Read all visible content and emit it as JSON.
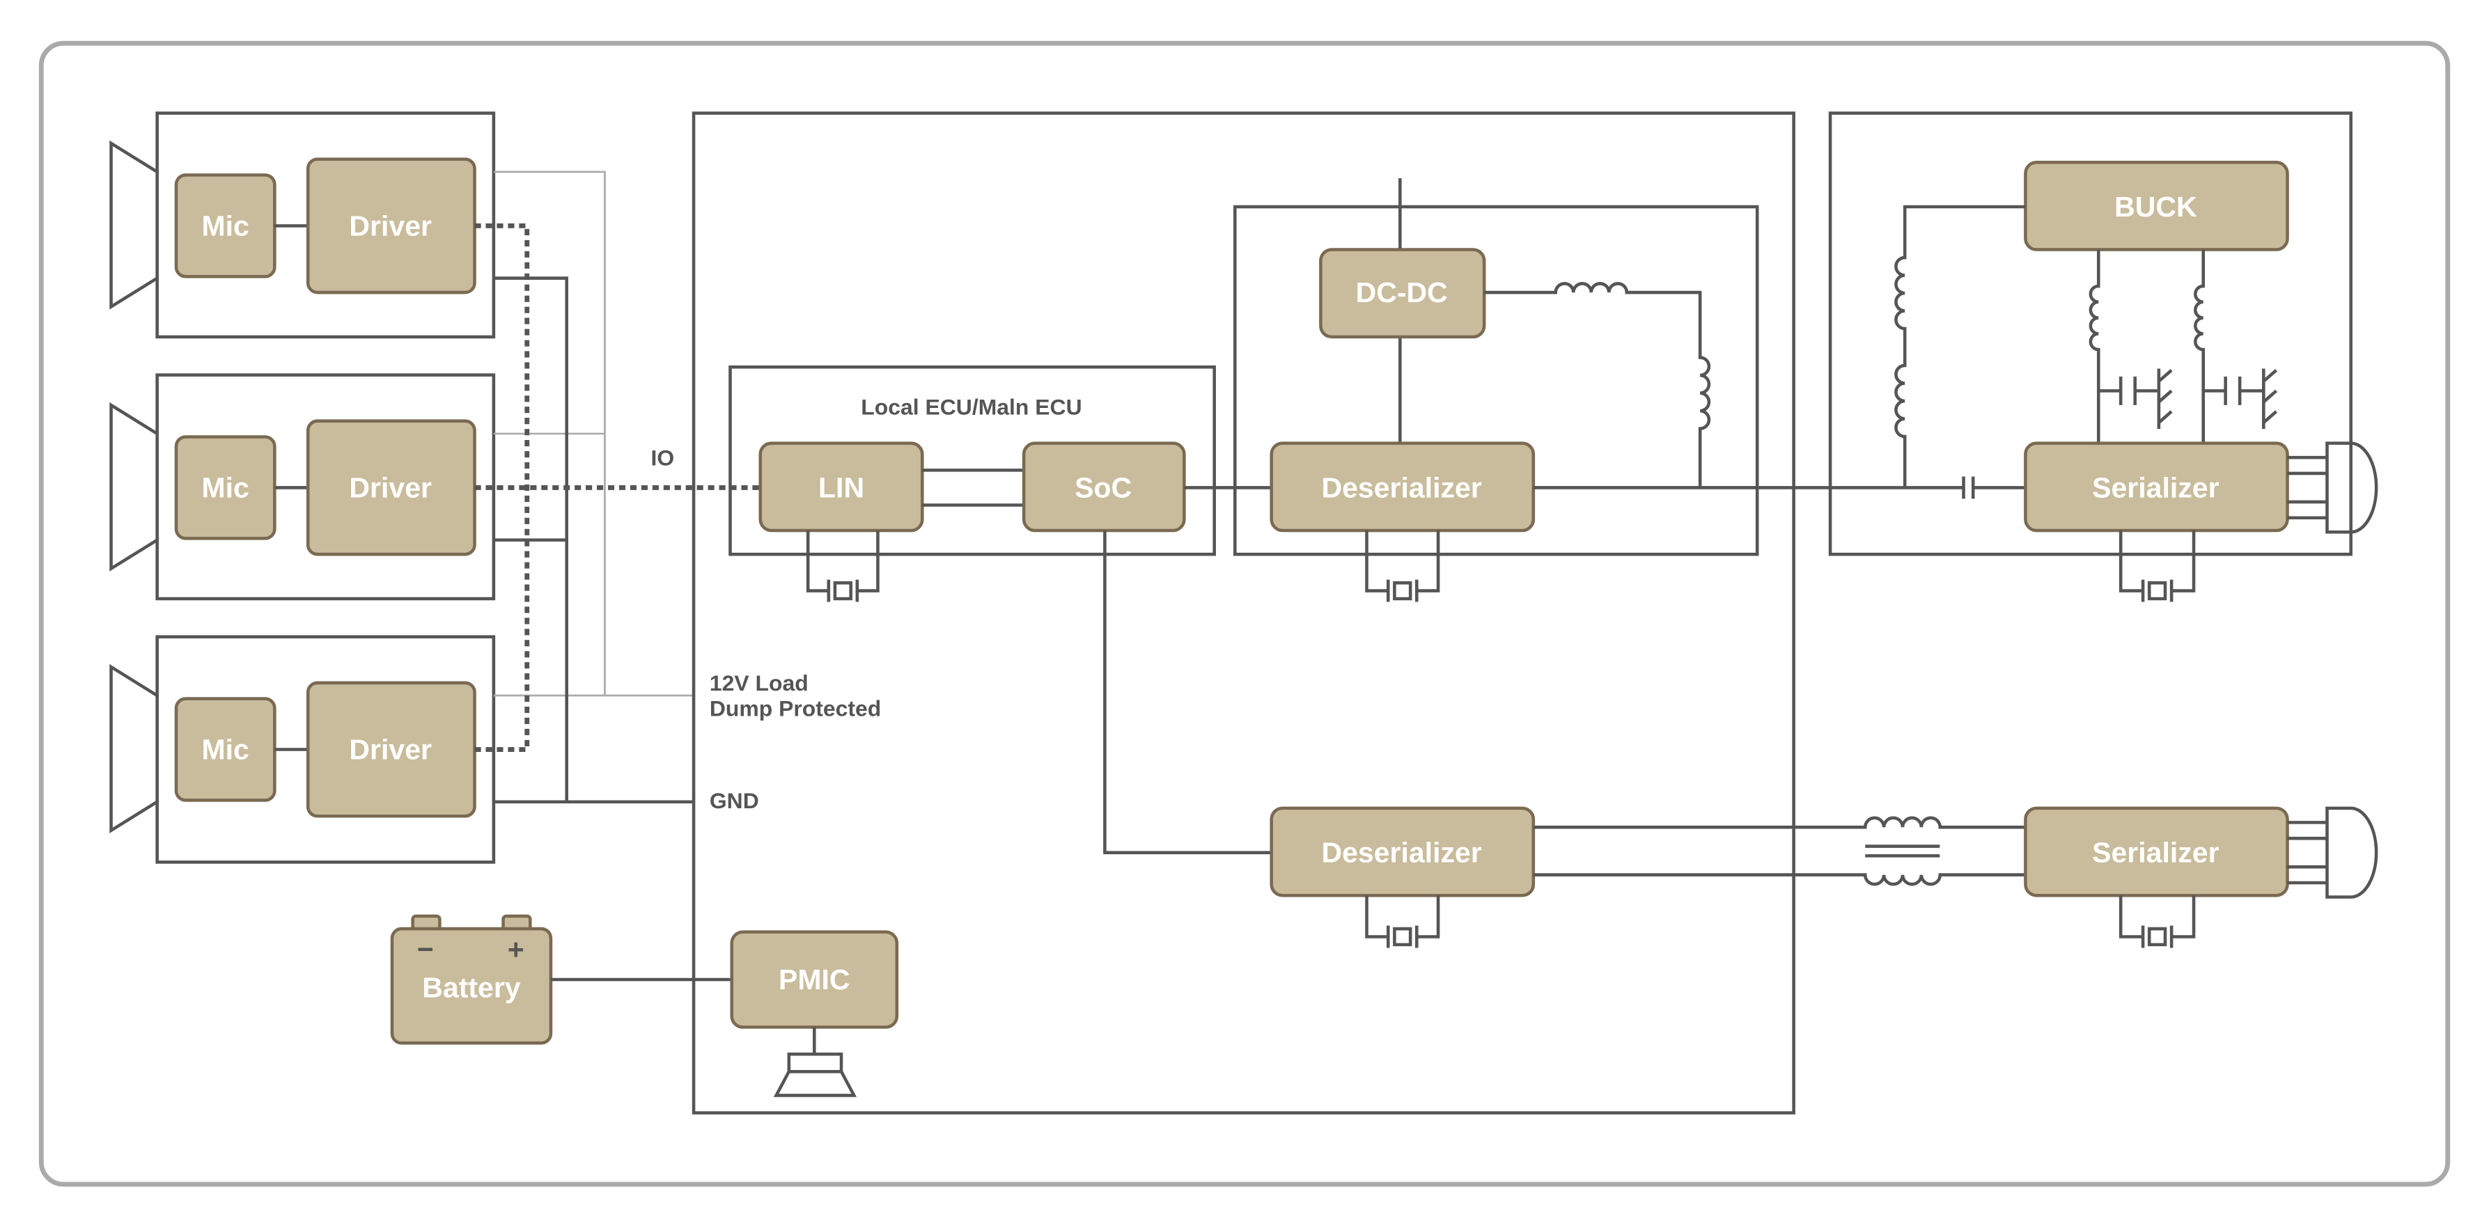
{
  "diagram": {
    "colors": {
      "block_fill": "#c9bc9c",
      "block_stroke": "#7a6a52",
      "line": "#555555",
      "frame": "#aaaaaa",
      "block_text": "#ffffff"
    },
    "modules": [
      {
        "mic": "Mic",
        "driver": "Driver"
      },
      {
        "mic": "Mic",
        "driver": "Driver"
      },
      {
        "mic": "Mic",
        "driver": "Driver"
      }
    ],
    "labels": {
      "io": "IO",
      "load_line1": "12V Load",
      "load_line2": "Dump Protected",
      "gnd": "GND",
      "ecu_title": "Local ECU/Maln ECU"
    },
    "blocks": {
      "lin": "LIN",
      "soc": "SoC",
      "dcdc": "DC-DC",
      "deserializer_top": "Deserializer",
      "deserializer_bottom": "Deserializer",
      "buck": "BUCK",
      "serializer_top": "Serializer",
      "serializer_bottom": "Serializer",
      "pmic": "PMIC",
      "battery": "Battery",
      "battery_minus": "−",
      "battery_plus": "+"
    }
  }
}
